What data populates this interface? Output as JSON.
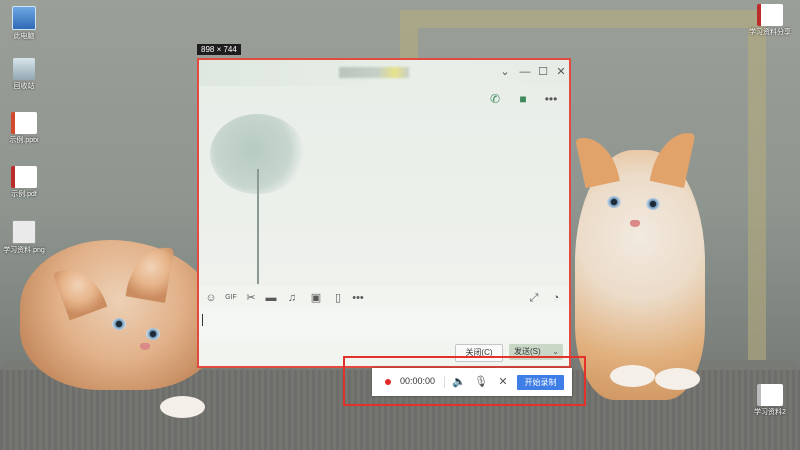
{
  "desktop": {
    "icons": [
      {
        "label": "此电脑",
        "icon": "computer-icon"
      },
      {
        "label": "回收站",
        "icon": "recycle-bin-icon"
      },
      {
        "label": "示例.pptx",
        "icon": "ppt-file-icon"
      },
      {
        "label": "示例.pdf",
        "icon": "pdf-file-icon"
      },
      {
        "label": "学习资料.png",
        "icon": "png-file-icon"
      },
      {
        "label": "学习资料分享",
        "icon": "pdf-file-icon"
      },
      {
        "label": "学习资料2",
        "icon": "document-icon"
      }
    ]
  },
  "size_tip": "898 × 744",
  "chat": {
    "title": "",
    "window_buttons": [
      "chevron-down-icon",
      "minimize-icon",
      "maximize-icon",
      "close-icon"
    ],
    "top_actions": [
      "voice-call-icon",
      "video-call-icon",
      "more-icon"
    ],
    "toolbar": [
      "emoji-icon",
      "gif-icon",
      "scissors-icon",
      "folder-icon",
      "music-icon",
      "image-icon",
      "screenshot-icon",
      "more-icon",
      "expand-icon",
      "history-icon"
    ],
    "input_value": "",
    "close_label": "关闭(C)",
    "send_label": "发送(S)"
  },
  "recorder": {
    "time": "00:00:00",
    "start_label": "开始录制",
    "icons": [
      "record-dot-icon",
      "speaker-icon",
      "microphone-icon",
      "close-icon"
    ],
    "colors": {
      "record": "#e32626",
      "button": "#3e7ee6",
      "highlight": "#e3322a"
    }
  }
}
